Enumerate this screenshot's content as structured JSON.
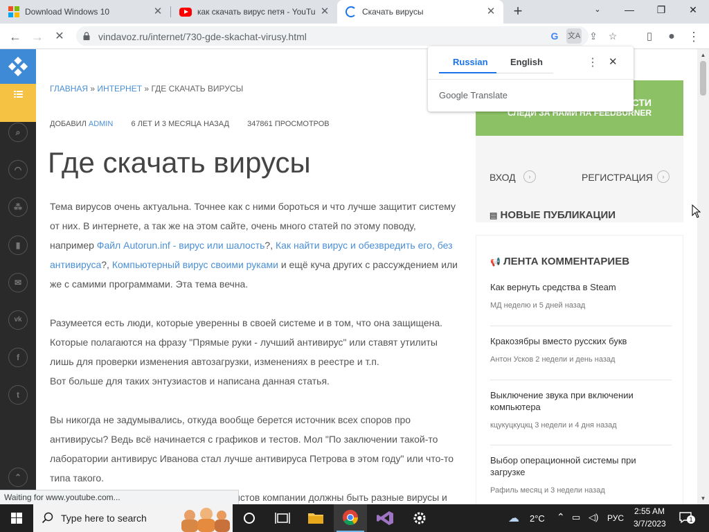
{
  "browser": {
    "tabs": [
      {
        "title": "Download Windows 10",
        "favicon": "windows-logo-icon",
        "active": false
      },
      {
        "title": "как скачать вирус петя - YouTub",
        "favicon": "youtube-icon",
        "active": false
      },
      {
        "title": "Скачать вирусы",
        "favicon": "loading-spinner-icon",
        "active": true
      }
    ],
    "new_tab_label": "+",
    "url": "vindavoz.ru/internet/730-gde-skachat-virusy.html",
    "status_text": "Waiting for www.youtube.com...",
    "accent_color": "#1a73e8"
  },
  "translate_popup": {
    "source_lang": "Russian",
    "target_lang": "English",
    "brand_google": "Google",
    "brand_translate": "Translate"
  },
  "page": {
    "breadcrumb": {
      "home": "ГЛАВНАЯ",
      "sep": "»",
      "section": "ИНТЕРНЕТ",
      "current": "ГДЕ СКАЧАТЬ ВИРУСЫ"
    },
    "meta": {
      "added_by_label": "ДОБАВИЛ",
      "author": "ADMIN",
      "age": "6 ЛЕТ И 3 МЕСЯЦА НАЗАД",
      "views": "347861 ПРОСМОТРОВ"
    },
    "title": "Где скачать вирусы",
    "para1": {
      "t1": "Тема вирусов очень актуальна. Точнее как с ними бороться и что лучше защитит систему от них. В интернете, а так же на этом сайте, очень много статей по этому поводу, например ",
      "link1": "Файл Autorun.inf - вирус или шалость",
      "t2": "?, ",
      "link2": "Как найти вирус и обезвредить его, без антивируса",
      "t3": "?, ",
      "link3": "Компьютерный вирус своими руками",
      "t4": " и ещё куча других с рассуждением или же с самими программами. Эта тема вечна."
    },
    "para2": "Разумеется есть люди, которые уверенны в своей системе и в том, что она защищена. Которые полагаются на фразу \"Прямые руки - лучший антивирус\" или ставят утилиты лишь для проверки изменения автозагрузки, изменениях в реестре и т.п.",
    "para2b": "Вот больше для таких энтузиастов и написана данная статья.",
    "para3": "Вы никогда не задумывались, откуда вообще берется источник всех споров про антивирусы? Ведь всё начинается с графиков и тестов. Мол \"По заключении такой-то лаборатории антивирус Иванова стал лучше антивируса Петрова в этом году\" или что-то типа такого.",
    "para4_partial": "истов компании должны быть разные вирусы и"
  },
  "sidebar_right": {
    "subscribe_line1": "СТИ",
    "subscribe_line2": "СЛЕДИ ЗА НАМИ НА FEEDBURNER",
    "subscribe_color": "#8cc265",
    "login": "ВХОД",
    "register": "РЕГИСТРАЦИЯ",
    "new_publications": "НОВЫЕ ПУБЛИКАЦИИ",
    "comments_feed": "ЛЕНТА КОММЕНТАРИЕВ",
    "comments": [
      {
        "title": "Как вернуть средства в Steam",
        "meta": "МД неделю и 5 дней назад"
      },
      {
        "title": "Кракозябры вместо русских букв",
        "meta": "Антон Усков 2 недели и день назад"
      },
      {
        "title": "Выключение звука при включении компьютера",
        "meta": "кцукуцкуцкц 3 недели и 4 дня назад"
      },
      {
        "title": "Выбор операционной системы при загрузке",
        "meta": "Рафиль месяц и 3 недели назад"
      }
    ]
  },
  "taskbar": {
    "search_placeholder": "Type here to search",
    "weather": "2°C",
    "language": "РУС",
    "time": "2:55 AM",
    "date": "3/7/2023",
    "notification_count": "1"
  }
}
